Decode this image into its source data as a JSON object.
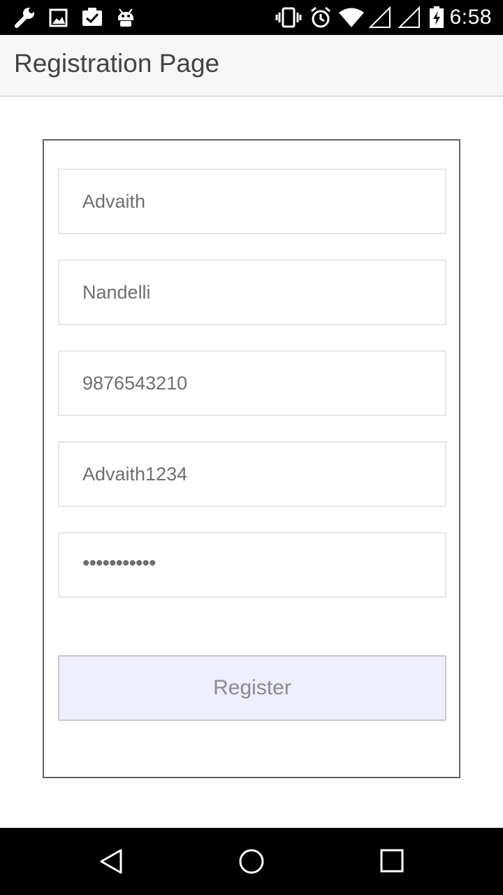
{
  "status_bar": {
    "time": "6:58",
    "left_icons": [
      "wrench-icon",
      "image-icon",
      "clipboard-check-icon",
      "android-icon"
    ],
    "right_icons": [
      "vibrate-icon",
      "alarm-icon",
      "wifi-icon",
      "signal-icon",
      "signal-icon",
      "battery-charging-icon"
    ]
  },
  "app_bar": {
    "title": "Registration Page"
  },
  "form": {
    "fields": [
      {
        "value": "Advaith"
      },
      {
        "value": "Nandelli"
      },
      {
        "value": "9876543210"
      },
      {
        "value": "Advaith1234"
      },
      {
        "value": "•••••••••••"
      }
    ],
    "register_label": "Register"
  },
  "nav_bar": {
    "buttons": [
      "back-icon",
      "home-icon",
      "recents-icon"
    ]
  },
  "colors": {
    "status_bar_bg": "#000000",
    "app_bar_bg": "#f7f7f7",
    "button_bg": "#eeeefc",
    "field_text": "#6f6f6f"
  }
}
